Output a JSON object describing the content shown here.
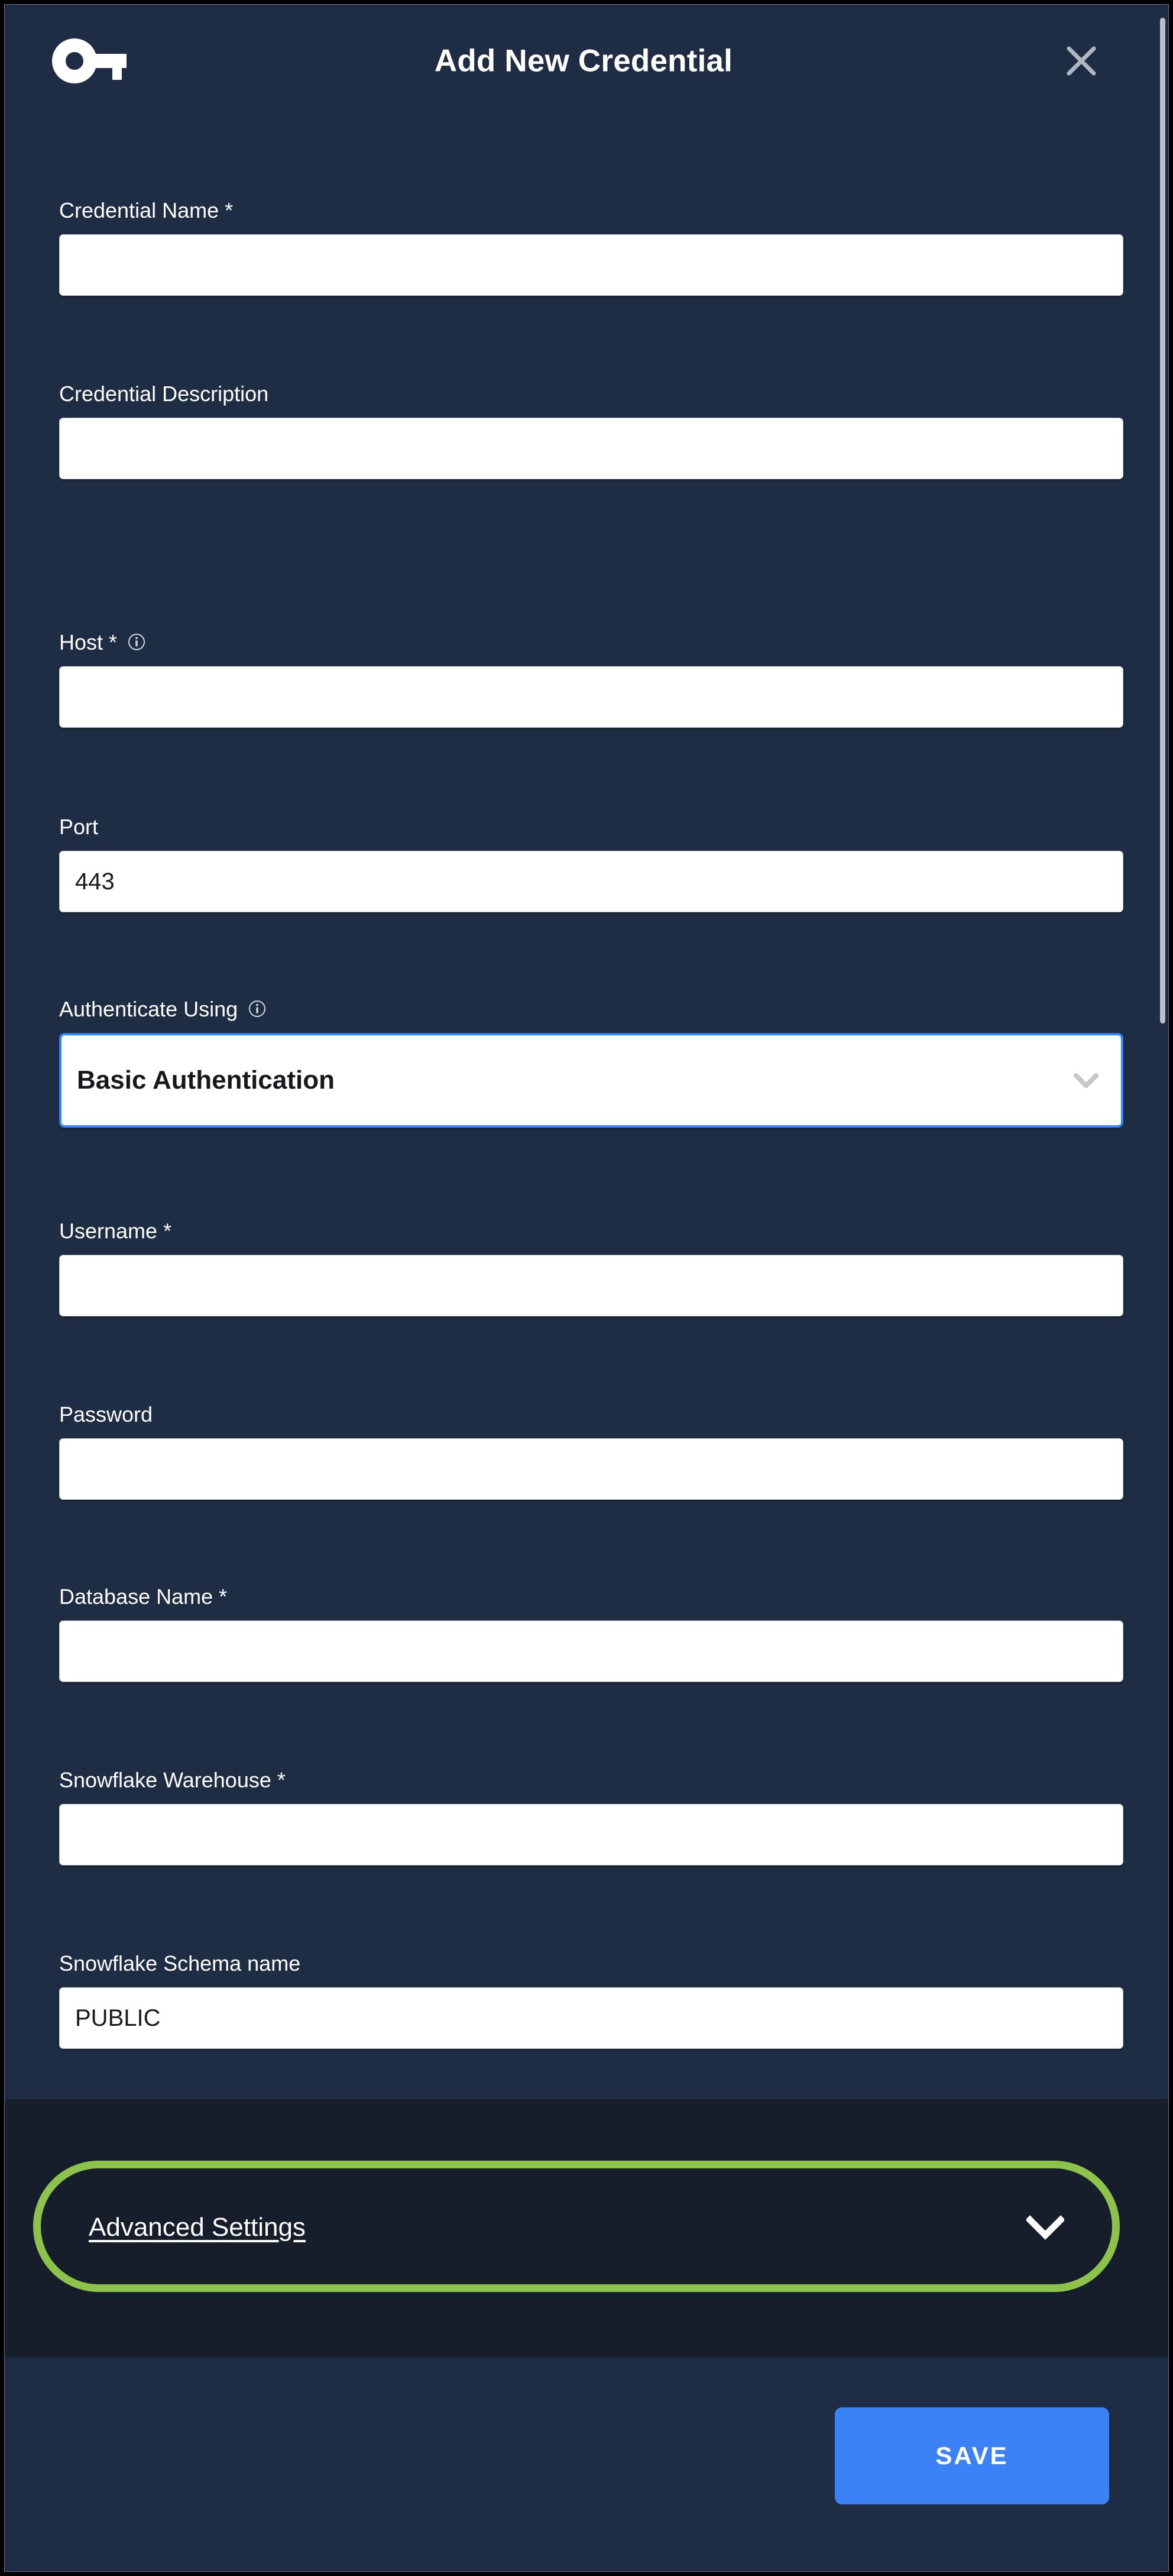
{
  "modal": {
    "title": "Add New Credential",
    "icon": "key-icon",
    "close_icon": "close-icon"
  },
  "form": {
    "fields": [
      {
        "id": "credential-name",
        "label": "Credential Name",
        "required_mark": "*",
        "value": "",
        "has_info": false,
        "type": "text"
      },
      {
        "id": "credential-description",
        "label": "Credential Description",
        "required_mark": "",
        "value": "",
        "has_info": false,
        "type": "text"
      },
      {
        "id": "host",
        "label": "Host",
        "required_mark": "*",
        "value": "",
        "has_info": true,
        "type": "text"
      },
      {
        "id": "port",
        "label": "Port",
        "required_mark": "",
        "value": "443",
        "has_info": false,
        "type": "text"
      },
      {
        "id": "authenticate-using",
        "label": "Authenticate Using",
        "required_mark": "",
        "value": "Basic Authentication",
        "has_info": true,
        "type": "select",
        "focused": true
      },
      {
        "id": "username",
        "label": "Username",
        "required_mark": "*",
        "value": "",
        "has_info": false,
        "type": "text"
      },
      {
        "id": "password",
        "label": "Password",
        "required_mark": "",
        "value": "",
        "has_info": false,
        "type": "password"
      },
      {
        "id": "database-name",
        "label": "Database Name",
        "required_mark": "*",
        "value": "",
        "has_info": false,
        "type": "text"
      },
      {
        "id": "snowflake-warehouse",
        "label": "Snowflake Warehouse",
        "required_mark": "*",
        "value": "",
        "has_info": false,
        "type": "text"
      },
      {
        "id": "snowflake-schema-name",
        "label": "Snowflake Schema name",
        "required_mark": "",
        "value": "PUBLIC",
        "has_info": false,
        "type": "text"
      }
    ]
  },
  "advanced": {
    "label": "Advanced Settings",
    "chevron_icon": "chevron-down-icon",
    "expanded": false,
    "highlight_color": "#8DC34A"
  },
  "footer": {
    "save_label": "SAVE",
    "save_color": "#3B82F6"
  },
  "colors": {
    "modal_background": "#1E2D44",
    "advanced_background": "#161E2B",
    "input_background": "#FFFFFF",
    "focus_border": "#2F86FF",
    "text": "#FFFFFF"
  }
}
